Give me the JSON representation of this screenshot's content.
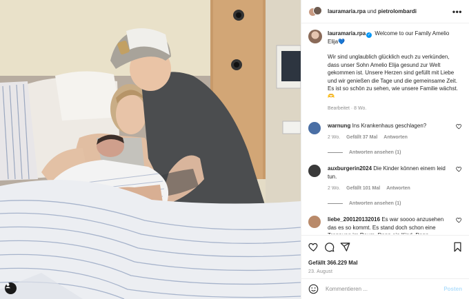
{
  "post": {
    "header": {
      "author1": "lauramaria.rpa",
      "joiner": "und",
      "author2": "pietrolombardi",
      "more_icon": "more-horizontal-icon",
      "more_glyph": "•••"
    },
    "caption": {
      "username": "lauramaria.rpa",
      "verified_icon": "verified-badge-icon",
      "headline": "Welcome to our Family Amelio Elija💙",
      "body": "Wir sind unglaublich glücklich euch zu verkünden, dass unser Sohn Amelio Elija gesund zur Welt gekommen ist. Unsere Herzen sind gefüllt mit Liebe und wir genießen die Tage und die gemeinsame Zeit.",
      "body2": "Es ist so schön zu sehen, wie unsere Familie wächst.🫶",
      "edited": "Bearbeitet",
      "time": "8 Wo."
    },
    "comments": [
      {
        "username": "warnung",
        "text": "Ins Krankenhaus geschlagen?",
        "time": "2 Wo.",
        "likes": "Gefällt 37 Mal",
        "reply": "Antworten",
        "view_replies": "Antworten ansehen (1)",
        "avatar_color": "#4a6fa5"
      },
      {
        "username": "auxburgerin2024",
        "text": "Die Kinder können einem leid tun.",
        "time": "2 Wo.",
        "likes": "Gefällt 101 Mal",
        "reply": "Antworten",
        "view_replies": "Antworten ansehen (1)",
        "avatar_color": "#3a3a3a"
      },
      {
        "username": "liebe_200120132016",
        "text": "Es war soooo anzusehen das es so kommt. Es stand doch schon eine Trennung im Raum, Dann ein Kind, Dann...",
        "avatar_color": "#b98a6a"
      }
    ],
    "actions": {
      "like_icon": "heart-icon",
      "comment_icon": "comment-icon",
      "share_icon": "share-icon",
      "save_icon": "bookmark-icon"
    },
    "likes": "Gefällt 366.229 Mal",
    "date": "23. August",
    "add_comment": {
      "emoji_icon": "emoji-icon",
      "placeholder": "Kommentieren ...",
      "post_label": "Posten"
    },
    "photo": {
      "tag_icon": "user-tag-icon"
    },
    "colors": {
      "link_blue": "#0095f6",
      "post_disabled": "#b2dffc",
      "muted": "#8e8e8e"
    }
  }
}
